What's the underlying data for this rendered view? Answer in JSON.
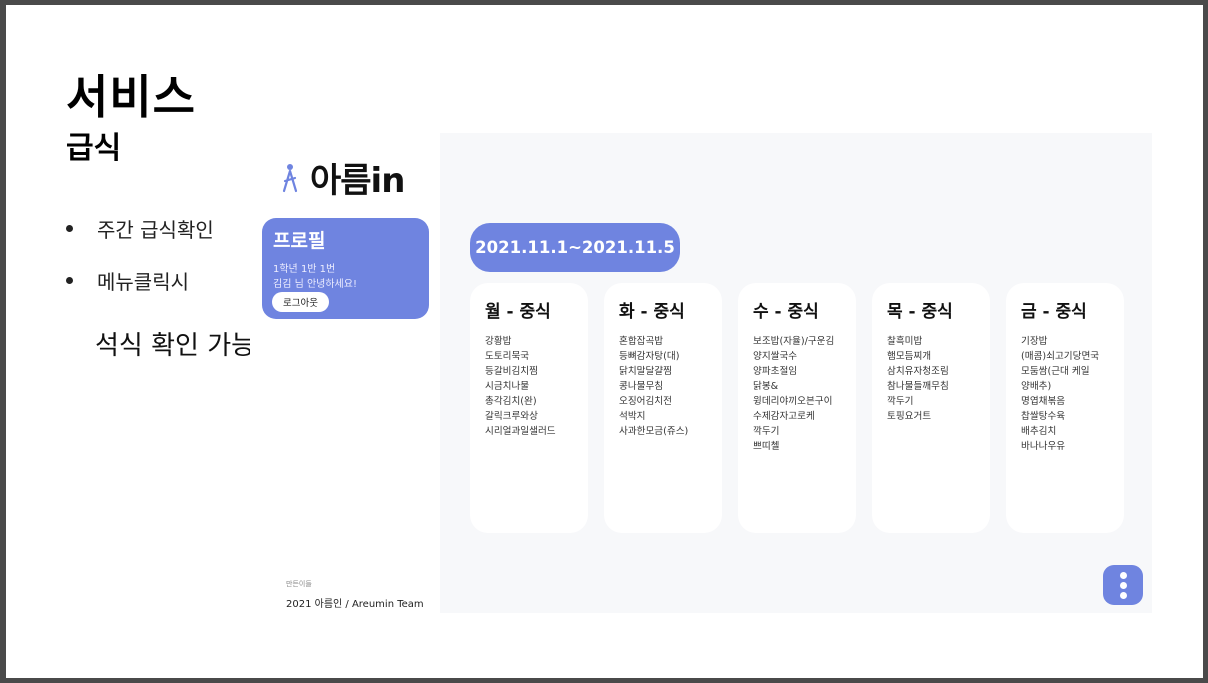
{
  "slide": {
    "title": "서비스",
    "subtitle": "급식",
    "bullets": [
      "주간 급식확인",
      "메뉴클릭시"
    ],
    "note": "석식 확인 가능"
  },
  "app": {
    "logo_text": "아름in",
    "profile": {
      "title": "프로필",
      "line1": "1학년 1반 1번",
      "line2": "김김 님 안녕하세요!",
      "logout_label": "로그아웃"
    },
    "footer": {
      "label": "만든이들",
      "team": "2021 아름인 / Areumin Team"
    },
    "week_range": "2021.11.1~2021.11.5",
    "days": [
      {
        "title": "월 - 중식",
        "menu": [
          "강황밥",
          "도토리묵국",
          "등갈비김치찜",
          "시금치나물",
          "총각김치(완)",
          "갈릭크루와상",
          "시리얼과일샐러드"
        ]
      },
      {
        "title": "화 - 중식",
        "menu": [
          "혼합잡곡밥",
          "등뼈감자탕(대)",
          "닭치말달걀찜",
          "콩나물무침",
          "오징어김치전",
          "석박지",
          "사과한모금(쥬스)"
        ]
      },
      {
        "title": "수 - 중식",
        "menu": [
          "보조밥(자율)/구운김",
          "양지쌀국수",
          "양파초절임",
          "닭봉&",
          "윙데리야끼오븐구이",
          "수제감자고로케",
          "깍두기",
          "쁘띠첼"
        ]
      },
      {
        "title": "목 - 중식",
        "menu": [
          "찰흑미밥",
          "햄모듬찌개",
          "삼치유자청조림",
          "참나물들깨무침",
          "깍두기",
          "토핑요거트"
        ]
      },
      {
        "title": "금 - 중식",
        "menu": [
          "기장밥",
          "(매콤)쇠고기당면국",
          "모둠쌈(근대 케일",
          "양배추)",
          "명엽채볶음",
          "찹쌀탕수육",
          "배추김치",
          "바나나우유"
        ]
      }
    ],
    "colors": {
      "accent": "#6f84e0",
      "main_bg": "#f7f8fa"
    }
  }
}
